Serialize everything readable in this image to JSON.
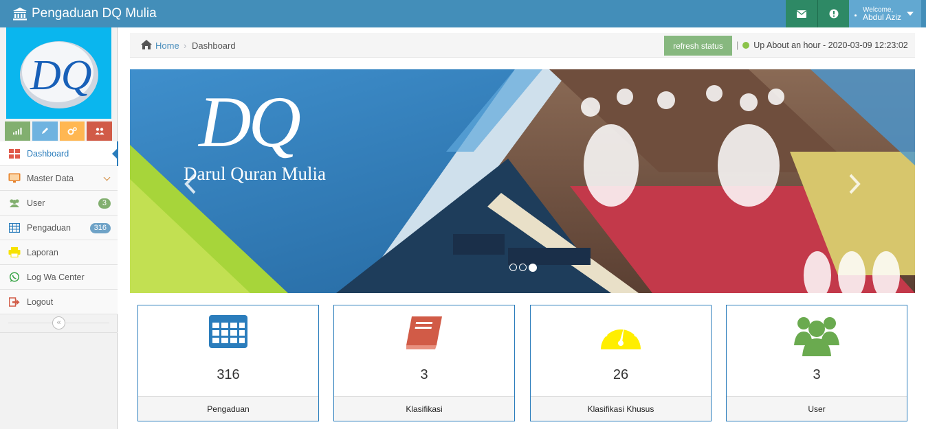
{
  "navbar": {
    "brand": "Pengaduan DQ Mulia",
    "welcome_label": "Welcome,",
    "user_name": "Abdul Aziz"
  },
  "sidebar": {
    "logo_text": "DQ",
    "items": [
      {
        "label": "Dashboard",
        "icon": "dashboard-tiles-icon"
      },
      {
        "label": "Master Data",
        "icon": "monitor-icon"
      },
      {
        "label": "User",
        "icon": "users-icon",
        "badge": "3"
      },
      {
        "label": "Pengaduan",
        "icon": "table-icon",
        "badge": "316"
      },
      {
        "label": "Laporan",
        "icon": "printer-icon"
      },
      {
        "label": "Log Wa Center",
        "icon": "whatsapp-icon"
      },
      {
        "label": "Logout",
        "icon": "logout-icon"
      }
    ]
  },
  "breadcrumb": {
    "home": "Home",
    "current": "Dashboard",
    "refresh_label": "refresh status",
    "status_text": "Up About an hour - 2020-03-09 12:23:02"
  },
  "banner": {
    "logo_text": "DQ",
    "title": "Darul Quran Mulia"
  },
  "stats": [
    {
      "value": "316",
      "label": "Pengaduan",
      "icon": "calendar-grid-icon",
      "color": "#2b7dbc"
    },
    {
      "value": "3",
      "label": "Klasifikasi",
      "icon": "book-icon",
      "color": "#d15b47"
    },
    {
      "value": "26",
      "label": "Klasifikasi Khusus",
      "icon": "dashboard-gauge-icon",
      "color": "#ffee00"
    },
    {
      "value": "3",
      "label": "User",
      "icon": "users-group-icon",
      "color": "#6aaa4f"
    }
  ],
  "colors": {
    "navbar": "#438eb9",
    "navbar_green": "#2e8965",
    "user_box": "#62a8d1",
    "accent": "#2b7dbc",
    "refresh": "#87b87f"
  }
}
